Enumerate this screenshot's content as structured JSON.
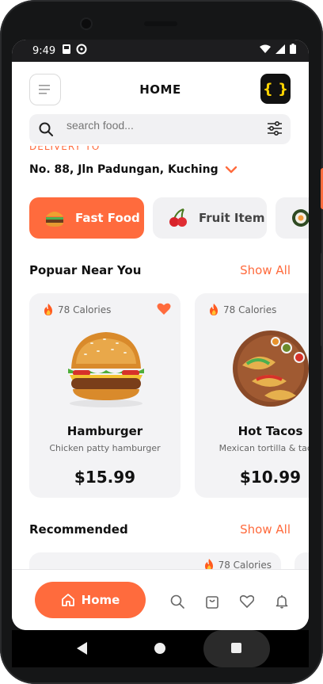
{
  "status_bar": {
    "time": "9:49"
  },
  "header": {
    "title": "HOME",
    "logo_text": "{ }"
  },
  "search": {
    "placeholder": "search food..."
  },
  "delivery": {
    "label": "DELIVERY TO",
    "address": "No. 88, Jln Padungan, Kuching"
  },
  "categories": [
    {
      "label": "Fast Food",
      "active": true,
      "icon": "burger-icon"
    },
    {
      "label": "Fruit Item",
      "active": false,
      "icon": "cherry-icon"
    },
    {
      "label": "",
      "active": false,
      "icon": "sushi-icon"
    }
  ],
  "popular": {
    "title": "Popuar Near You",
    "show_all": "Show All",
    "items": [
      {
        "calories": "78 Calories",
        "name": "Hamburger",
        "description": "Chicken patty hamburger",
        "price": "$15.99",
        "favorite": true
      },
      {
        "calories": "78 Calories",
        "name": "Hot Tacos",
        "description": "Mexican tortilla & tacos",
        "price": "$10.99",
        "favorite": false
      }
    ]
  },
  "recommended": {
    "title": "Recommended",
    "show_all": "Show All",
    "items": [
      {
        "calories": "78 Calories"
      }
    ]
  },
  "bottom_nav": {
    "home_label": "Home"
  },
  "colors": {
    "accent": "#ff6b3d",
    "card_bg": "#f3f3f5",
    "text": "#111111"
  }
}
